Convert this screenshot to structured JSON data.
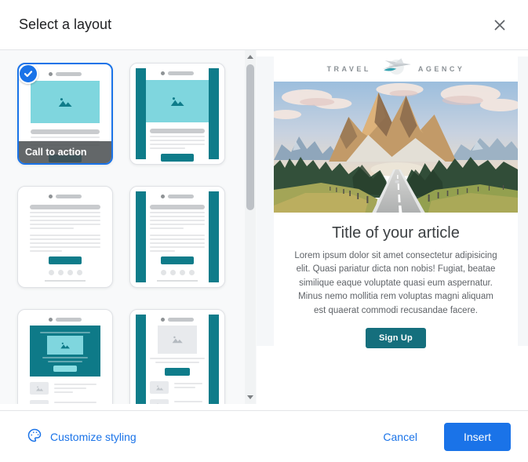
{
  "header": {
    "title": "Select a layout"
  },
  "layouts": {
    "items": [
      {
        "name": "call-to-action",
        "label": "Call to action",
        "selected": true,
        "style": "image-text-button"
      },
      {
        "name": "call-to-action-sidebars",
        "selected": false,
        "style": "image-text-button-teal-sidebars"
      },
      {
        "name": "text-only",
        "selected": false,
        "style": "text-button"
      },
      {
        "name": "text-only-sidebars",
        "selected": false,
        "style": "text-button-teal-sidebars"
      },
      {
        "name": "featured-content",
        "selected": false,
        "style": "teal-block-media-rows"
      },
      {
        "name": "featured-content-sidebars",
        "selected": false,
        "style": "gray-image-media-rows-teal-sidebars"
      }
    ]
  },
  "preview": {
    "logo": {
      "left": "TRAVEL",
      "right": "AGENCY"
    },
    "hero_image": "mountain-road-landscape",
    "article": {
      "title": "Title of your article",
      "body": "Lorem ipsum dolor sit amet consectetur adipisicing elit. Quasi pariatur dicta non nobis! Fugiat, beatae similique eaque voluptate quasi eum aspernatur. Minus nemo mollitia rem voluptas magni aliquam est quaerat commodi recusandae facere.",
      "cta_label": "Sign Up"
    }
  },
  "footer": {
    "customize_label": "Customize styling",
    "cancel_label": "Cancel",
    "insert_label": "Insert"
  },
  "colors": {
    "accent_blue": "#1a73e8",
    "teal": "#0f7c8a",
    "teal_light": "#7fd6de",
    "page_background": "#f5f7f9"
  }
}
